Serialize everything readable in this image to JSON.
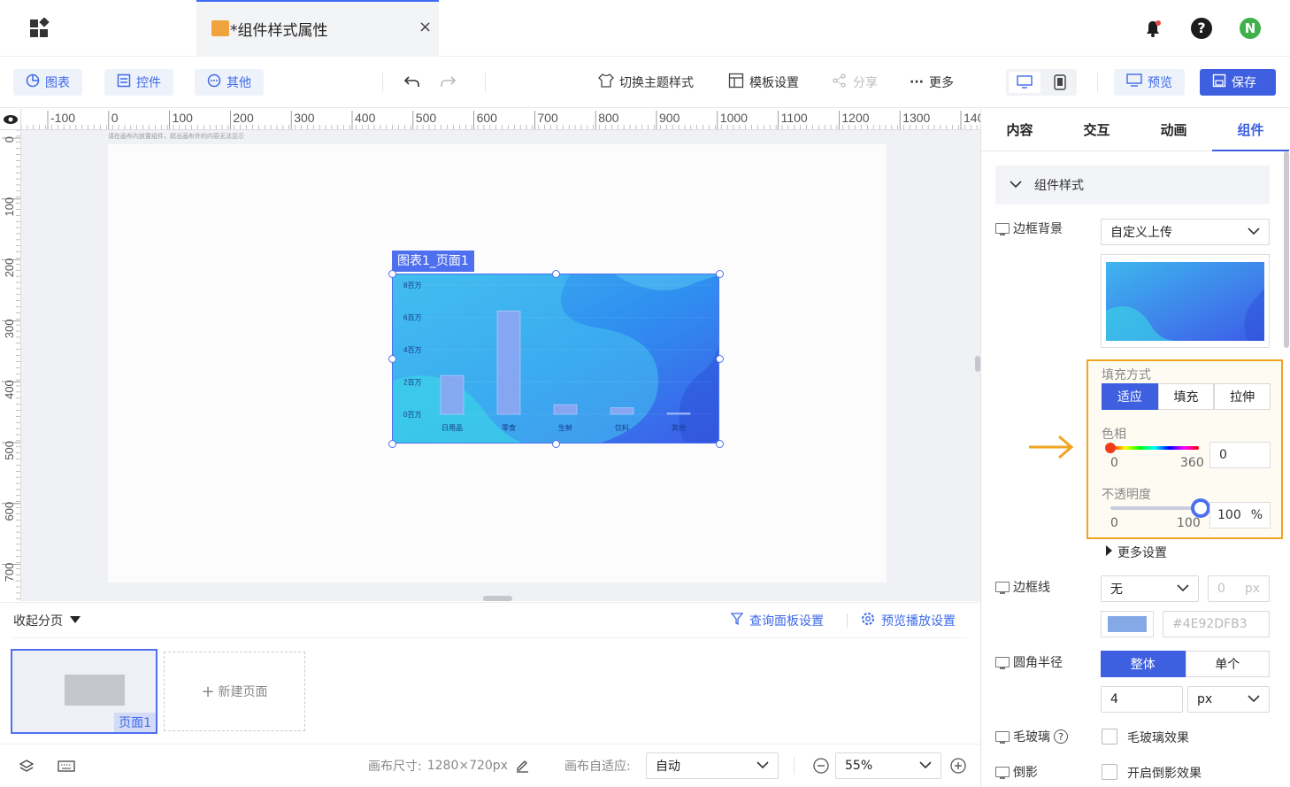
{
  "tab": {
    "title": "*组件样式属性",
    "close": "×"
  },
  "header": {
    "notify_icon": "bell-icon",
    "help": "?",
    "avatar": "N"
  },
  "toolbar": {
    "chart": "图表",
    "control": "控件",
    "other": "其他",
    "theme": "切换主题样式",
    "template": "模板设置",
    "share": "分享",
    "more": "更多",
    "preview": "预览",
    "save": "保存"
  },
  "ruler": {
    "top": [
      "-100",
      "0",
      "100",
      "200",
      "300",
      "400",
      "500",
      "600",
      "700",
      "800",
      "900",
      "1000",
      "1100",
      "1200",
      "1300",
      "140"
    ],
    "left": [
      "0",
      "100",
      "200",
      "300",
      "400",
      "500",
      "600",
      "700"
    ]
  },
  "canvas": {
    "hint": "请在画布内放置组件，超出画布外的内容无法显示"
  },
  "chart_widget": {
    "tag": "图表1_页面1"
  },
  "chart_data": {
    "type": "bar",
    "categories": [
      "日用品",
      "零食",
      "生鲜",
      "饮料",
      "其他"
    ],
    "values": [
      2.4,
      6.4,
      0.6,
      0.4,
      0.05
    ],
    "ylabels": [
      "8百万",
      "6百万",
      "4百万",
      "2百万",
      "0百万"
    ],
    "ylim": [
      0,
      8
    ]
  },
  "pages": {
    "collapse": "收起分页",
    "query_panel": "查询面板设置",
    "preview_play": "预览播放设置",
    "page1": "页面1",
    "new_page": "新建页面"
  },
  "status": {
    "canvas_size_label": "画布尺寸:",
    "canvas_size": "1280×720px",
    "fit_label": "画布自适应:",
    "fit_value": "自动",
    "zoom": "55%"
  },
  "panel": {
    "tabs": [
      "内容",
      "交互",
      "动画",
      "组件"
    ],
    "section": "组件样式",
    "border_bg_label": "边框背景",
    "border_bg_value": "自定义上传",
    "fill_mode_label": "填充方式",
    "fill_modes": [
      "适应",
      "填充",
      "拉伸"
    ],
    "hue_label": "色相",
    "hue_min": "0",
    "hue_max": "360",
    "hue_value": "0",
    "opacity_label": "不透明度",
    "opacity_min": "0",
    "opacity_max": "100",
    "opacity_value": "100",
    "opacity_unit": "%",
    "more_settings": "更多设置",
    "border_line_label": "边框线",
    "border_line_value": "无",
    "border_width": "0",
    "border_unit": "px",
    "border_color": "#4E92DFB3",
    "radius_label": "圆角半径",
    "radius_modes": [
      "整体",
      "单个"
    ],
    "radius_value": "4",
    "radius_unit": "px",
    "frost_label": "毛玻璃",
    "frost_check": "毛玻璃效果",
    "reflect_label": "倒影",
    "reflect_check": "开启倒影效果"
  },
  "colors": {
    "accent": "#3d5fe0",
    "highlight": "#f0a421"
  }
}
